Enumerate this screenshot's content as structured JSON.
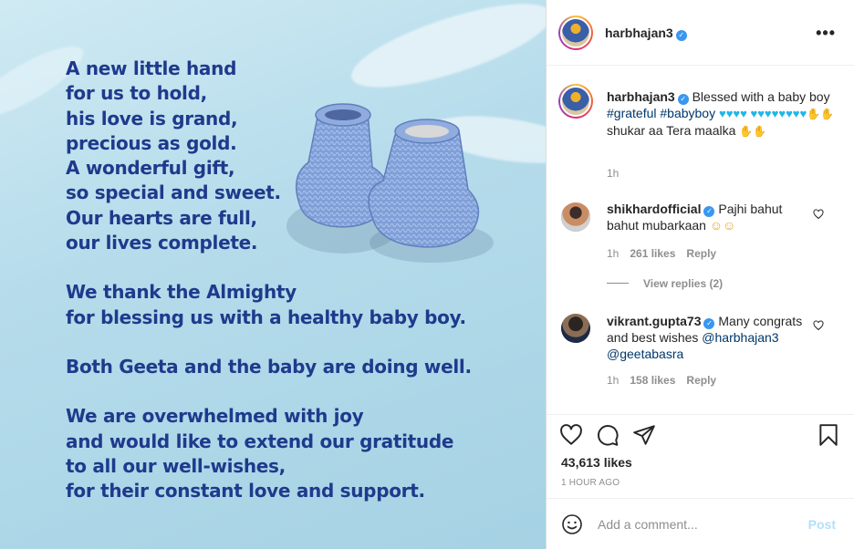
{
  "media": {
    "poem_lines": [
      "A new little hand",
      "for us to hold,",
      "his love is grand,",
      "precious as gold.",
      "A wonderful gift,",
      "so special and sweet.",
      "Our hearts are full,",
      "our lives complete.",
      "",
      "We thank the Almighty",
      "for blessing us with a healthy baby boy.",
      "",
      "Both Geeta and the baby are doing well.",
      "",
      "We are overwhelmed with joy",
      "and would like to extend our gratitude",
      "to all our well-wishes,",
      "for their constant love and support."
    ]
  },
  "header": {
    "username": "harbhajan3",
    "more_icon": "more-horizontal-icon"
  },
  "caption": {
    "username": "harbhajan3",
    "text_prefix": "Blessed with a baby boy",
    "hashtag1": "#grateful",
    "hashtag2": "#babyboy",
    "text_suffix": "shukar aa Tera maalka",
    "time": "1h"
  },
  "comments": [
    {
      "username": "shikhardofficial",
      "text": "Pajhi bahut bahut mubarkaan",
      "time": "1h",
      "likes": "261 likes",
      "reply": "Reply",
      "view_replies": "View replies (2)"
    },
    {
      "username": "vikrant.gupta73",
      "text": "Many congrats and best wishes",
      "mention1": "@harbhajan3",
      "mention2": "@geetabasra",
      "time": "1h",
      "likes": "158 likes",
      "reply": "Reply"
    }
  ],
  "actions": {
    "likes": "43,613 likes",
    "time_ago": "1 HOUR AGO"
  },
  "composer": {
    "placeholder": "Add a comment...",
    "post_label": "Post"
  },
  "colors": {
    "verified": "#3897f0",
    "link": "#00376b",
    "poem": "#1f3a8c",
    "post_disabled": "#b2dffc"
  }
}
